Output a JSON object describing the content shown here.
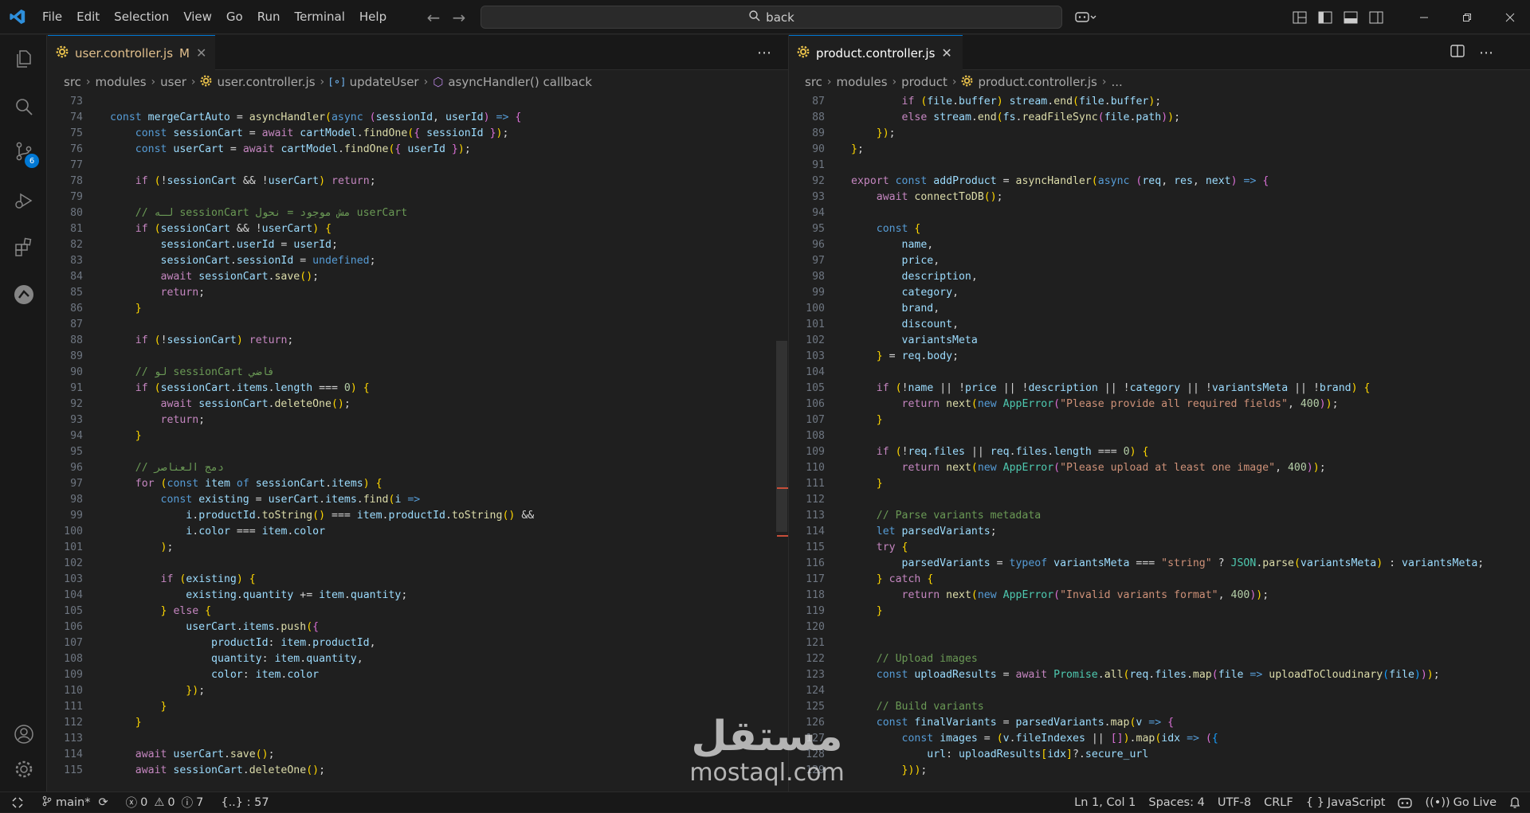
{
  "titlebar": {
    "menu": [
      "File",
      "Edit",
      "Selection",
      "View",
      "Go",
      "Run",
      "Terminal",
      "Help"
    ],
    "search": "back"
  },
  "activity": {
    "source_control_badge": "6"
  },
  "left_editor": {
    "tab_label": "user.controller.js",
    "tab_status": "M",
    "breadcrumb": [
      "src",
      "modules",
      "user",
      "user.controller.js",
      "updateUser",
      "asyncHandler() callback"
    ],
    "lines": [
      {
        "n": "73",
        "code": ""
      },
      {
        "n": "74",
        "code": "const mergeCartAuto = asyncHandler(async (sessionId, userId) => {"
      },
      {
        "n": "75",
        "code": "    const sessionCart = await cartModel.findOne({ sessionId });"
      },
      {
        "n": "76",
        "code": "    const userCart = await cartModel.findOne({ userId });"
      },
      {
        "n": "77",
        "code": ""
      },
      {
        "n": "78",
        "code": "    if (!sessionCart && !userCart) return;"
      },
      {
        "n": "79",
        "code": ""
      },
      {
        "n": "80",
        "code": "    // لـه sessionCart مش موجود = نحول userCart"
      },
      {
        "n": "81",
        "code": "    if (sessionCart && !userCart) {"
      },
      {
        "n": "82",
        "code": "        sessionCart.userId = userId;"
      },
      {
        "n": "83",
        "code": "        sessionCart.sessionId = undefined;"
      },
      {
        "n": "84",
        "code": "        await sessionCart.save();"
      },
      {
        "n": "85",
        "code": "        return;"
      },
      {
        "n": "86",
        "code": "    }"
      },
      {
        "n": "87",
        "code": ""
      },
      {
        "n": "88",
        "code": "    if (!sessionCart) return;"
      },
      {
        "n": "89",
        "code": ""
      },
      {
        "n": "90",
        "code": "    // لو sessionCart فاضي"
      },
      {
        "n": "91",
        "code": "    if (sessionCart.items.length === 0) {"
      },
      {
        "n": "92",
        "code": "        await sessionCart.deleteOne();"
      },
      {
        "n": "93",
        "code": "        return;"
      },
      {
        "n": "94",
        "code": "    }"
      },
      {
        "n": "95",
        "code": ""
      },
      {
        "n": "96",
        "code": "    // دمج العناصر"
      },
      {
        "n": "97",
        "code": "    for (const item of sessionCart.items) {"
      },
      {
        "n": "98",
        "code": "        const existing = userCart.items.find(i =>"
      },
      {
        "n": "99",
        "code": "            i.productId.toString() === item.productId.toString() &&"
      },
      {
        "n": "100",
        "code": "            i.color === item.color"
      },
      {
        "n": "101",
        "code": "        );"
      },
      {
        "n": "102",
        "code": ""
      },
      {
        "n": "103",
        "code": "        if (existing) {"
      },
      {
        "n": "104",
        "code": "            existing.quantity += item.quantity;"
      },
      {
        "n": "105",
        "code": "        } else {"
      },
      {
        "n": "106",
        "code": "            userCart.items.push({"
      },
      {
        "n": "107",
        "code": "                productId: item.productId,"
      },
      {
        "n": "108",
        "code": "                quantity: item.quantity,"
      },
      {
        "n": "109",
        "code": "                color: item.color"
      },
      {
        "n": "110",
        "code": "            });"
      },
      {
        "n": "111",
        "code": "        }"
      },
      {
        "n": "112",
        "code": "    }"
      },
      {
        "n": "113",
        "code": ""
      },
      {
        "n": "114",
        "code": "    await userCart.save();"
      },
      {
        "n": "115",
        "code": "    await sessionCart.deleteOne();"
      }
    ]
  },
  "right_editor": {
    "tab_label": "product.controller.js",
    "breadcrumb": [
      "src",
      "modules",
      "product",
      "product.controller.js",
      "..."
    ],
    "lines": [
      {
        "n": "87",
        "code": "        if (file.buffer) stream.end(file.buffer);"
      },
      {
        "n": "88",
        "code": "        else stream.end(fs.readFileSync(file.path));"
      },
      {
        "n": "89",
        "code": "    });"
      },
      {
        "n": "90",
        "code": "};"
      },
      {
        "n": "91",
        "code": ""
      },
      {
        "n": "92",
        "code": "export const addProduct = asyncHandler(async (req, res, next) => {"
      },
      {
        "n": "93",
        "code": "    await connectToDB();"
      },
      {
        "n": "94",
        "code": ""
      },
      {
        "n": "95",
        "code": "    const {"
      },
      {
        "n": "96",
        "code": "        name,"
      },
      {
        "n": "97",
        "code": "        price,"
      },
      {
        "n": "98",
        "code": "        description,"
      },
      {
        "n": "99",
        "code": "        category,"
      },
      {
        "n": "100",
        "code": "        brand,"
      },
      {
        "n": "101",
        "code": "        discount,"
      },
      {
        "n": "102",
        "code": "        variantsMeta"
      },
      {
        "n": "103",
        "code": "    } = req.body;"
      },
      {
        "n": "104",
        "code": ""
      },
      {
        "n": "105",
        "code": "    if (!name || !price || !description || !category || !variantsMeta || !brand) {"
      },
      {
        "n": "106",
        "code": "        return next(new AppError(\"Please provide all required fields\", 400));"
      },
      {
        "n": "107",
        "code": "    }"
      },
      {
        "n": "108",
        "code": ""
      },
      {
        "n": "109",
        "code": "    if (!req.files || req.files.length === 0) {"
      },
      {
        "n": "110",
        "code": "        return next(new AppError(\"Please upload at least one image\", 400));"
      },
      {
        "n": "111",
        "code": "    }"
      },
      {
        "n": "112",
        "code": ""
      },
      {
        "n": "113",
        "code": "    // Parse variants metadata"
      },
      {
        "n": "114",
        "code": "    let parsedVariants;"
      },
      {
        "n": "115",
        "code": "    try {"
      },
      {
        "n": "116",
        "code": "        parsedVariants = typeof variantsMeta === \"string\" ? JSON.parse(variantsMeta) : variantsMeta;"
      },
      {
        "n": "117",
        "code": "    } catch {"
      },
      {
        "n": "118",
        "code": "        return next(new AppError(\"Invalid variants format\", 400));"
      },
      {
        "n": "119",
        "code": "    }"
      },
      {
        "n": "120",
        "code": ""
      },
      {
        "n": "121",
        "code": ""
      },
      {
        "n": "122",
        "code": "    // Upload images"
      },
      {
        "n": "123",
        "code": "    const uploadResults = await Promise.all(req.files.map(file => uploadToCloudinary(file)));"
      },
      {
        "n": "124",
        "code": ""
      },
      {
        "n": "125",
        "code": "    // Build variants"
      },
      {
        "n": "126",
        "code": "    const finalVariants = parsedVariants.map(v => {"
      },
      {
        "n": "127",
        "code": "        const images = (v.fileIndexes || []).map(idx => ({"
      },
      {
        "n": "128",
        "code": "            url: uploadResults[idx]?.secure_url"
      },
      {
        "n": "129",
        "code": "        }));"
      }
    ]
  },
  "statusbar": {
    "branch": "main*",
    "errors": "0",
    "warnings": "0",
    "info": "7",
    "selection": "{..} : 57",
    "position": "Ln 1, Col 1",
    "spaces": "Spaces: 4",
    "encoding": "UTF-8",
    "eol": "CRLF",
    "language": "JavaScript",
    "golive": "Go Live"
  },
  "watermark": {
    "arabic": "مستقل",
    "latin": "mostaql.com"
  },
  "colors": {
    "accent": "#0078d4",
    "js_icon": "#e8c04a",
    "keyword": "#569cd6",
    "control": "#c586c0",
    "function": "#dcdcaa",
    "variable": "#9cdcfe",
    "string": "#ce9178",
    "number": "#b5cea8",
    "comment": "#6a9955"
  }
}
